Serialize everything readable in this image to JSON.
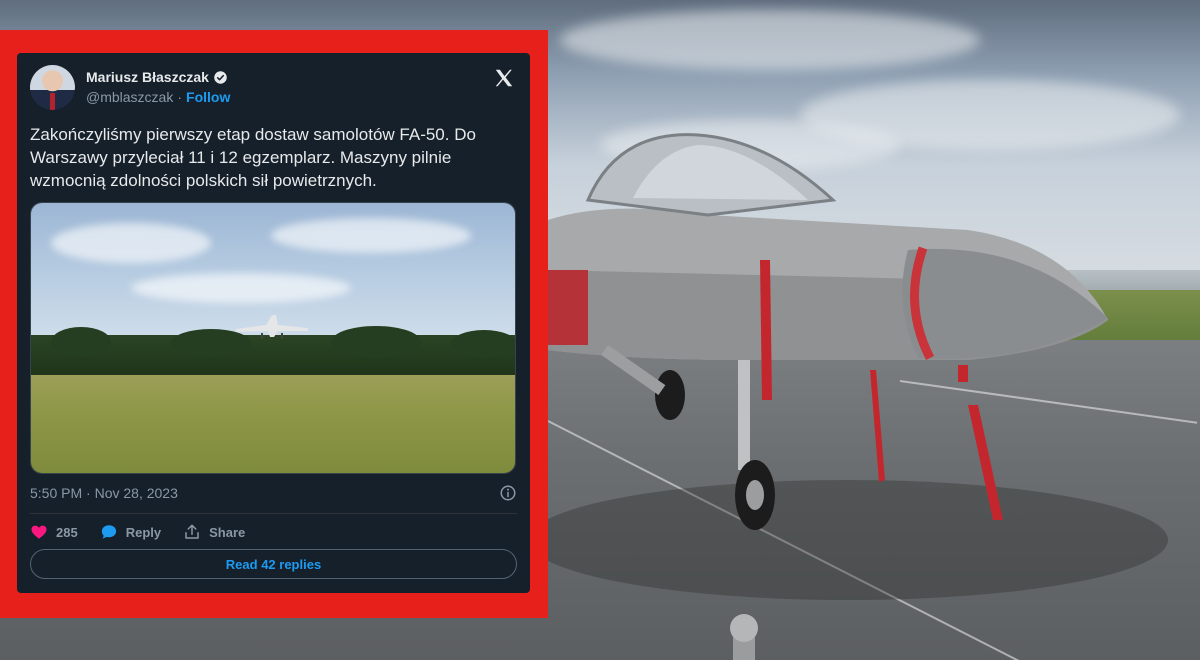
{
  "tweet": {
    "author_name": "Mariusz Błaszczak",
    "handle": "@mblaszczak",
    "separator": "·",
    "follow_label": "Follow",
    "text": "Zakończyliśmy pierwszy etap dostaw samolotów FA-50. Do Warszawy przyleciał 11 i 12 egzemplarz. Maszyny pilnie wzmocnią zdolności polskich sił powietrznych.",
    "timestamp": "5:50 PM · Nov 28, 2023",
    "like_count": "285",
    "reply_label": "Reply",
    "share_label": "Share",
    "read_replies_label": "Read 42 replies"
  },
  "icons": {
    "logo": "x-logo-icon",
    "verified": "verified-badge-icon",
    "info": "info-icon",
    "like": "heart-icon",
    "reply": "reply-bubble-icon",
    "share": "share-icon"
  },
  "colors": {
    "frame_red": "#e8201c",
    "card_bg": "#15202b",
    "accent_blue": "#1d9bf0",
    "like_pink": "#f91880",
    "muted_text": "#8b98a5"
  }
}
